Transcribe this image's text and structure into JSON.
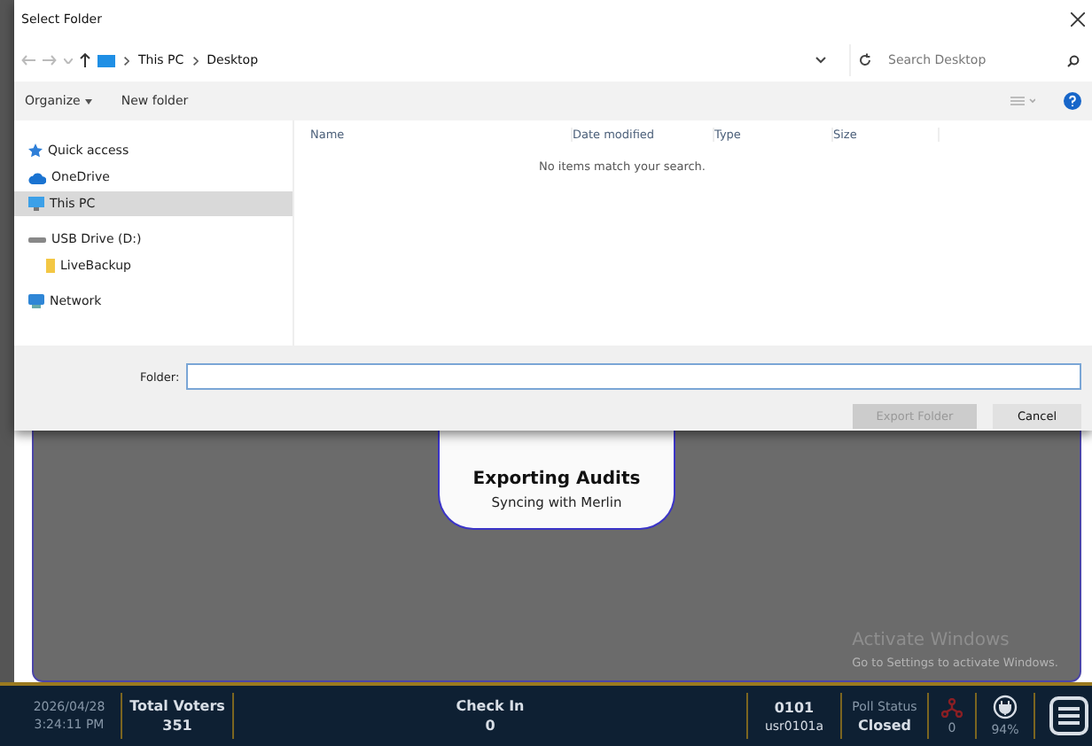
{
  "dialog": {
    "title": "Select Folder",
    "breadcrumb": [
      "This PC",
      "Desktop"
    ],
    "search": {
      "placeholder": "Search Desktop"
    },
    "toolbar": [
      {
        "label": "Organize",
        "kind": "menu"
      },
      {
        "label": "New folder",
        "kind": "plain"
      }
    ],
    "nav": [
      {
        "label": "Quick access",
        "kind": "star",
        "selected": false
      },
      {
        "label": "OneDrive",
        "kind": "cloud",
        "selected": false
      },
      {
        "label": "This PC",
        "kind": "pc",
        "selected": true
      },
      {
        "label": "USB Drive (D:)",
        "kind": "drive",
        "selected": false,
        "children": [
          {
            "label": "LiveBackup",
            "kind": "folder",
            "selected": false
          }
        ]
      },
      {
        "label": "Network",
        "kind": "network",
        "selected": false
      }
    ],
    "columns": [
      "Name",
      "Date modified",
      "Type",
      "Size"
    ],
    "empty_message": "No items match your search.",
    "folder_label": "Folder:",
    "buttons": [
      {
        "label": "Export Folder",
        "disabled": true
      },
      {
        "label": "Cancel",
        "disabled": false
      }
    ]
  },
  "progress": {
    "title": "Exporting Audits",
    "subtitle": "Syncing with Merlin"
  },
  "activation": {
    "title": "Activate Windows",
    "subtitle": "Go to Settings to activate Windows."
  },
  "status_bar": {
    "date": "2026/04/28",
    "time": "3:24:11 PM",
    "total_voters": {
      "label": "Total Voters",
      "value": "351"
    },
    "check_in": {
      "label": "Check In",
      "value": "0"
    },
    "precinct": {
      "code": "0101",
      "user": "usr0101a"
    },
    "poll_status": {
      "label": "Poll Status",
      "value": "Closed"
    },
    "network_count": "0",
    "battery": "94%"
  }
}
